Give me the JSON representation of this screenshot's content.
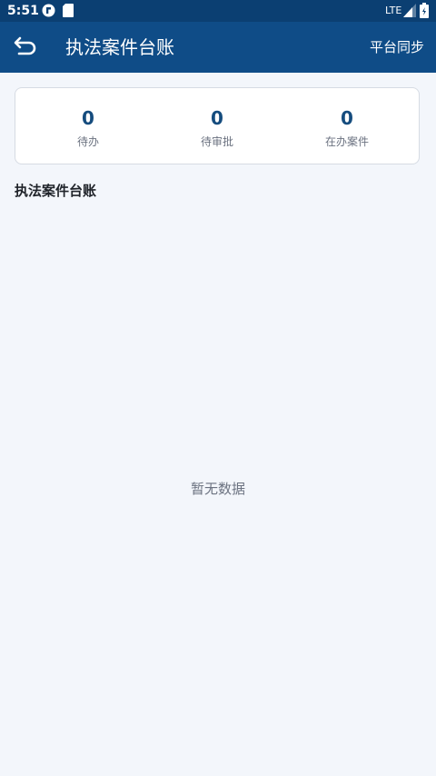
{
  "status_bar": {
    "time": "5:51",
    "network": "LTE",
    "icons": [
      "app-notification-icon",
      "sd-card-icon",
      "signal-icon",
      "battery-icon"
    ]
  },
  "app_bar": {
    "back_icon": "back-arrow-icon",
    "title": "执法案件台账",
    "action_label": "平台同步"
  },
  "summary": {
    "items": [
      {
        "value": "0",
        "label": "待办"
      },
      {
        "value": "0",
        "label": "待审批"
      },
      {
        "value": "0",
        "label": "在办案件"
      }
    ]
  },
  "section": {
    "title": "执法案件台账"
  },
  "empty_state": {
    "text": "暂无数据"
  },
  "colors": {
    "status_bar_bg": "#0b3f72",
    "app_bar_bg": "#0f4c87",
    "page_bg": "#f3f6fb",
    "stat_value": "#154c7e"
  }
}
